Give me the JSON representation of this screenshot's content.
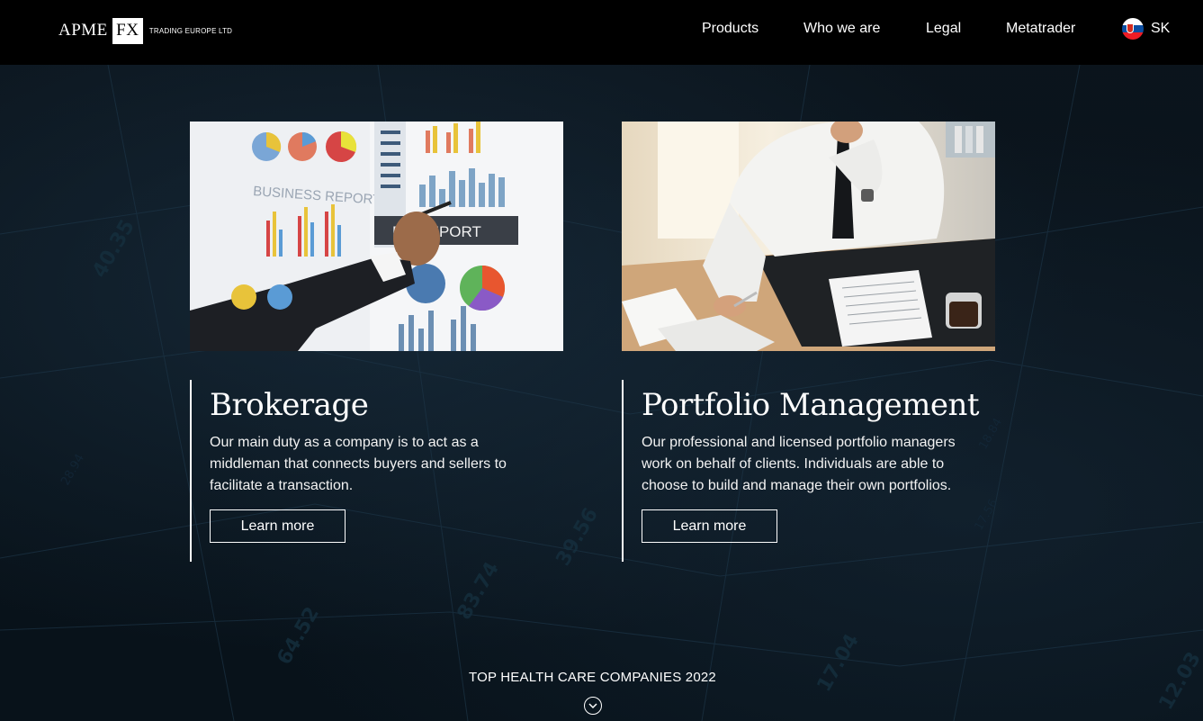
{
  "header": {
    "logo": {
      "part1": "APME",
      "part2": "FX",
      "tagline": "TRADING EUROPE LTD"
    },
    "nav": [
      "Products",
      "Who we are",
      "Legal",
      "Metatrader"
    ],
    "language": {
      "code": "SK",
      "flag_icon": "slovakia-flag-icon"
    }
  },
  "cards": [
    {
      "title": "Brokerage",
      "text": "Our main duty as a company is to act as a middleman that connects buyers and sellers to facilitate a transaction.",
      "button": "Learn more",
      "image": "business-report-photo"
    },
    {
      "title": "Portfolio Management",
      "text": "Our professional and licensed portfolio managers work on behalf of clients. Individuals are able to choose to build and manage their own portfolios.",
      "button": "Learn more",
      "image": "businessman-at-desk-photo"
    }
  ],
  "bottom": {
    "title": "TOP HEALTH CARE COMPANIES 2022",
    "scroll_icon": "chevron-down-circle-icon"
  },
  "colors": {
    "header_bg": "#000000",
    "page_bg": "#0a1118",
    "text": "#ffffff"
  }
}
